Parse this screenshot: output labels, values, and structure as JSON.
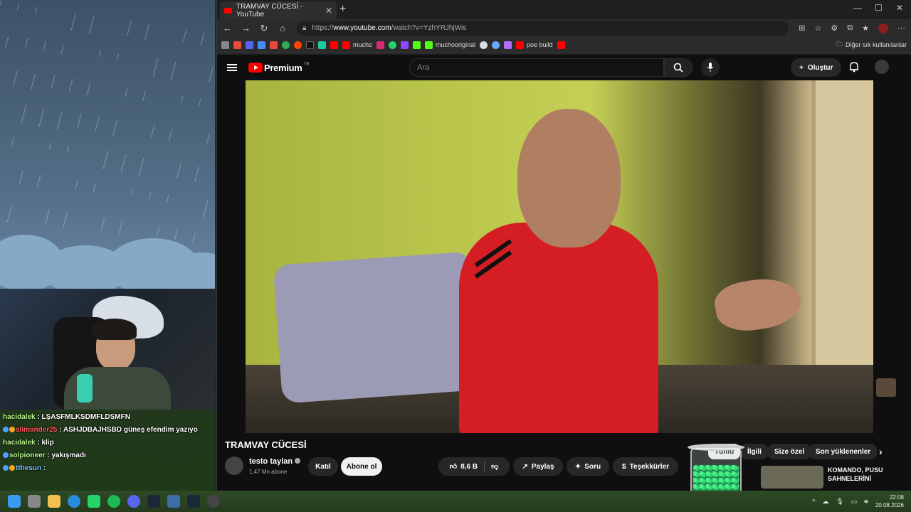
{
  "browser": {
    "tab_title": "TRAMVAY CÜCESİ - YouTube",
    "url_prefix": "https://",
    "url_host": "www.youtube.com",
    "url_path": "/watch?v=YzhYRJhjWis",
    "bookmarks": [
      {
        "label": "",
        "icon": "gmail-icon",
        "color": "#e84b3c"
      },
      {
        "label": "mucho",
        "icon": "youtube-icon",
        "color": "#ff0000"
      },
      {
        "label": "muchooriginal",
        "icon": "kick-icon",
        "color": "#53fc18"
      },
      {
        "label": "poe build",
        "icon": "youtube-icon",
        "color": "#ff0000"
      }
    ],
    "bookmarks_folder": "Diğer sık kullanılanlar"
  },
  "youtube": {
    "logo_text": "Premium",
    "logo_region": "TR",
    "search_placeholder": "Ara",
    "create_label": "Oluştur",
    "video_title": "TRAMVAY CÜCESİ",
    "channel_name": "testo taylan",
    "channel_subs": "1,47 Mn abone",
    "join_label": "Katıl",
    "subscribe_label": "Abone ol",
    "likes": "8,6 B",
    "share_label": "Paylaş",
    "ask_label": "Soru",
    "thanks_label": "Teşekkürler",
    "chips": [
      "Tümü",
      "İlgili",
      "Size özel",
      "Son yüklenenler"
    ],
    "rec_title_line1": "KOMANDO, PUSU",
    "rec_title_line2": "SAHNELERİNİ"
  },
  "chat": [
    {
      "user": "hacidalek",
      "msg": "LŞASFMLKSDMFLDSMFN",
      "color": "green"
    },
    {
      "user": "alimander25",
      "msg": "ASHJDBAJHSBD güneş efendim yazıyo",
      "color": "red"
    },
    {
      "user": "hacidalek",
      "msg": "klip",
      "color": "green"
    },
    {
      "user": "solpioneer",
      "msg": "yakışmadı",
      "color": "green"
    },
    {
      "user": "tthesun",
      "msg": "",
      "color": "blue"
    }
  ],
  "taskbar": {
    "time": "22:08",
    "date": "20.08.2026"
  }
}
